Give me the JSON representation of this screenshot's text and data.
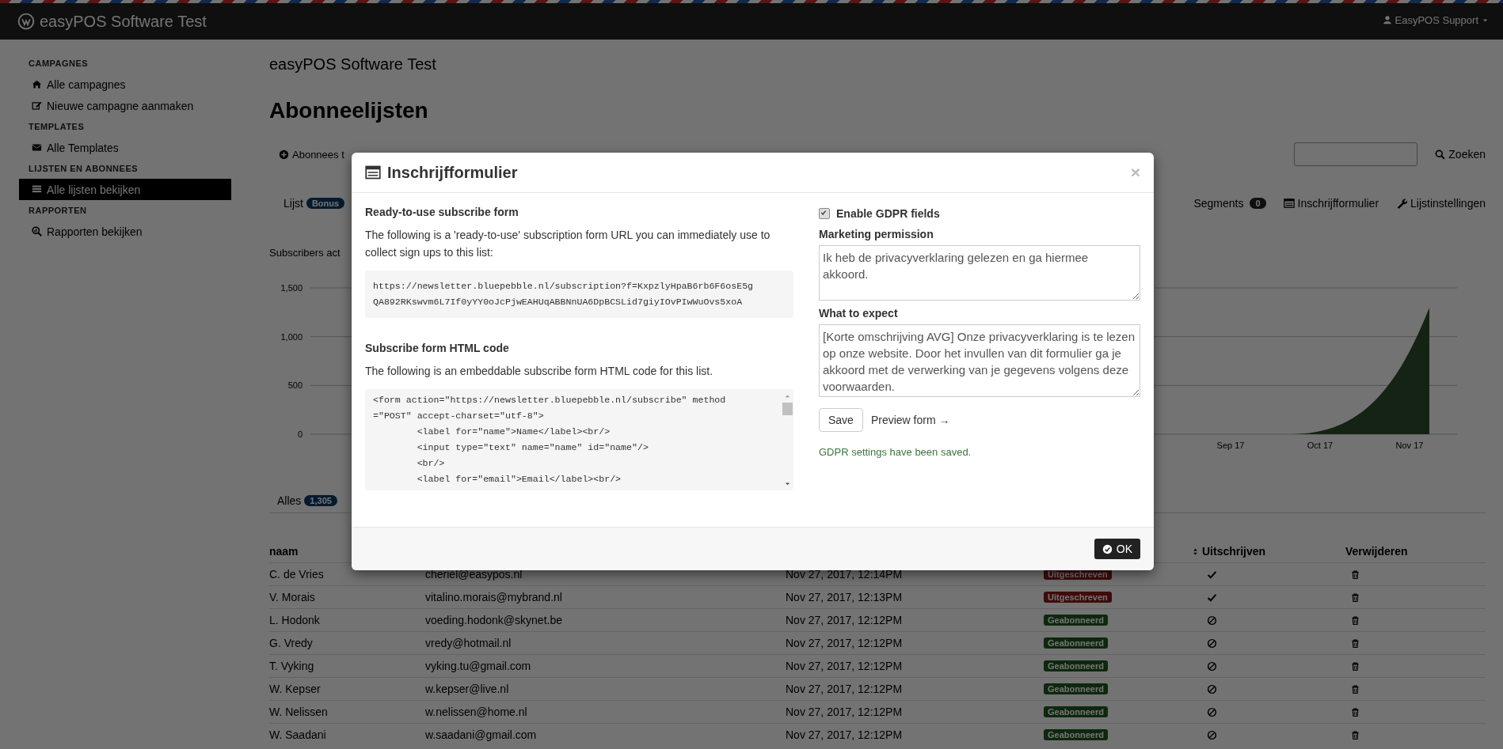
{
  "topbar": {
    "brand": "easyPOS Software Test",
    "user": "EasyPOS Support"
  },
  "sidebar": {
    "sections": [
      {
        "heading": "CAMPAGNES",
        "items": [
          {
            "label": "Alle campagnes",
            "selected": false
          },
          {
            "label": "Nieuwe campagne aanmaken",
            "selected": false
          }
        ]
      },
      {
        "heading": "TEMPLATES",
        "items": [
          {
            "label": "Alle Templates",
            "selected": false
          }
        ]
      },
      {
        "heading": "LIJSTEN EN ABONNEES",
        "items": [
          {
            "label": "Alle lijsten bekijken",
            "selected": true
          }
        ]
      },
      {
        "heading": "RAPPORTEN",
        "items": [
          {
            "label": "Rapporten bekijken",
            "selected": false
          }
        ]
      }
    ]
  },
  "page": {
    "subtitle": "easyPOS Software Test",
    "title": "Abonneelijsten",
    "toolbar": [
      {
        "label": "Abonnees t"
      }
    ],
    "search": {
      "button": "Zoeken"
    },
    "list_bar": {
      "label": "Lijst",
      "badge": "Bonus",
      "tabs": [
        {
          "label": "Segments",
          "badge": "0"
        },
        {
          "label": "Inschrijfformulier"
        },
        {
          "label": "Lijstinstellingen"
        }
      ]
    },
    "chart_caption": "Subscribers act",
    "chart": {
      "y_labels": [
        "1,500",
        "1,000",
        "500",
        "0"
      ],
      "x_labels": [
        "Sep 17",
        "Oct 17",
        "Nov 17"
      ]
    },
    "filter": {
      "label": "Alles",
      "count": "1,305"
    },
    "table": {
      "columns": [
        {
          "label": "naam",
          "sortable": false
        },
        {
          "label": "Uitschrijven",
          "sortable": true
        },
        {
          "label": "Verwijderen",
          "sortable": false
        }
      ],
      "rows": [
        {
          "name": "C. de Vries",
          "email": "cheriel@easypos.nl",
          "date": "Nov 27, 2017, 12:14PM",
          "status": "Uitgeschreven",
          "kind": "unsubscribed"
        },
        {
          "name": "V. Morais",
          "email": "vitalino.morais@mybrand.nl",
          "date": "Nov 27, 2017, 12:13PM",
          "status": "Uitgeschreven",
          "kind": "unsubscribed"
        },
        {
          "name": "L. Hodonk",
          "email": "voeding.hodonk@skynet.be",
          "date": "Nov 27, 2017, 12:12PM",
          "status": "Geabonneerd",
          "kind": "subscribed"
        },
        {
          "name": "G. Vredy",
          "email": "vredy@hotmail.nl",
          "date": "Nov 27, 2017, 12:12PM",
          "status": "Geabonneerd",
          "kind": "subscribed"
        },
        {
          "name": "T. Vyking",
          "email": "vyking.tu@gmail.com",
          "date": "Nov 27, 2017, 12:12PM",
          "status": "Geabonneerd",
          "kind": "subscribed"
        },
        {
          "name": "W. Kepser",
          "email": "w.kepser@live.nl",
          "date": "Nov 27, 2017, 12:12PM",
          "status": "Geabonneerd",
          "kind": "subscribed"
        },
        {
          "name": "W. Nelissen",
          "email": "w.nelissen@home.nl",
          "date": "Nov 27, 2017, 12:12PM",
          "status": "Geabonneerd",
          "kind": "subscribed"
        },
        {
          "name": "W. Saadani",
          "email": "w.saadani@gmail.com",
          "date": "Nov 27, 2017, 12:12PM",
          "status": "Geabonneerd",
          "kind": "subscribed"
        }
      ]
    }
  },
  "modal": {
    "title": "Inschrijfformulier",
    "close": "×",
    "ready_heading": "Ready-to-use subscribe form",
    "ready_text": "The following is a 'ready-to-use' subscription form URL you can immediately use to collect sign ups to this list:",
    "url_lines": [
      "https://newsletter.bluepebble.nl/subscription?f=KxpzlyHpaB6rb6F6osE5g",
      "QA892RKswvm6L7If0yYY0oJcPjwEAHUqABBNnUA6DpBCSLid7giyIOvPIwWuOvs5xoA"
    ],
    "html_heading": "Subscribe form HTML code",
    "html_text": "The following is an embeddable subscribe form HTML code for this list.",
    "code_lines": [
      "<form action=\"https://newsletter.bluepebble.nl/subscribe\" method",
      "=\"POST\" accept-charset=\"utf-8\">",
      "        <label for=\"name\">Name</label><br/>",
      "        <input type=\"text\" name=\"name\" id=\"name\"/>",
      "        <br/>",
      "        <label for=\"email\">Email</label><br/>"
    ],
    "gdpr": {
      "label": "Enable GDPR fields",
      "checked": true
    },
    "permission_label": "Marketing permission",
    "permission_value": "Ik heb de privacyverklaring gelezen en ga hiermee akkoord.",
    "expect_label": "What to expect",
    "expect_value": "[Korte omschrijving AVG] Onze privacyverklaring is te lezen op onze website. Door het invullen van dit formulier ga je akkoord met de verwerking van je gegevens volgens deze voorwaarden.",
    "save": "Save",
    "preview": "Preview form →",
    "message": "GDPR settings have been saved.",
    "ok": "OK"
  }
}
